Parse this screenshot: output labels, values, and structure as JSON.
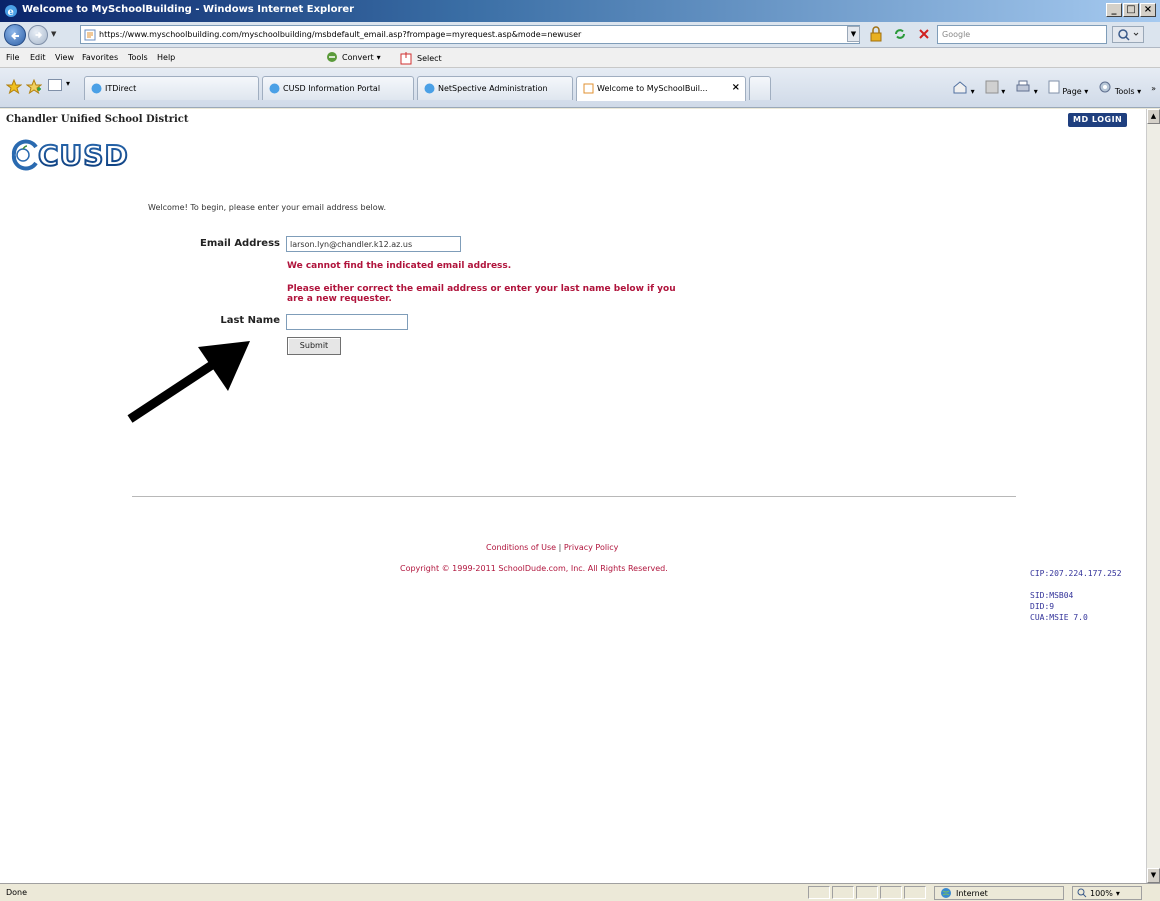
{
  "window": {
    "title": "Welcome to MySchoolBuilding - Windows Internet Explorer",
    "buttons": [
      "_",
      "□",
      "×"
    ]
  },
  "addressbar": {
    "url": "https://www.myschoolbuilding.com/myschoolbuilding/msbdefault_email.asp?frompage=myrequest.asp&mode=newuser",
    "search_placeholder": "Google"
  },
  "menubar": {
    "items": [
      "File",
      "Edit",
      "View",
      "Favorites",
      "Tools",
      "Help"
    ],
    "convert_label": "Convert",
    "select_label": "Select"
  },
  "tabs": [
    {
      "label": "ITDirect"
    },
    {
      "label": "CUSD Information Portal"
    },
    {
      "label": "NetSpective Administration"
    },
    {
      "label": "Welcome to MySchoolBuil...",
      "active": true
    }
  ],
  "commandbar": {
    "page_label": "Page",
    "tools_label": "Tools"
  },
  "page": {
    "district_name": "Chandler Unified School District",
    "md_login": "MD LOGIN",
    "logo_text": "CUSD",
    "welcome_text": "Welcome! To begin, please enter your email address below.",
    "email_label": "Email Address",
    "email_value": "larson.lyn@chandler.k12.az.us",
    "error_not_found": "We cannot find the indicated email address.",
    "error_instruction": "Please either correct the email address or enter your last name below if you are a new requester.",
    "lastname_label": "Last Name",
    "lastname_value": "",
    "submit_label": "Submit"
  },
  "footer": {
    "conditions": "Conditions of Use",
    "separator": "|",
    "privacy": "Privacy Policy",
    "copyright": "Copyright © 1999-2011 SchoolDude.com, Inc. All Rights Reserved."
  },
  "diagnostics": {
    "cip": "CIP:207.224.177.252",
    "sid": "SID:MSB04",
    "did": "DID:9",
    "cua": "CUA:MSIE 7.0"
  },
  "statusbar": {
    "status": "Done",
    "zone": "Internet",
    "zoom": "100%"
  },
  "colors": {
    "error_red": "#b0143c",
    "diag_blue": "#33339a",
    "login_blue": "#1f3f7f"
  }
}
